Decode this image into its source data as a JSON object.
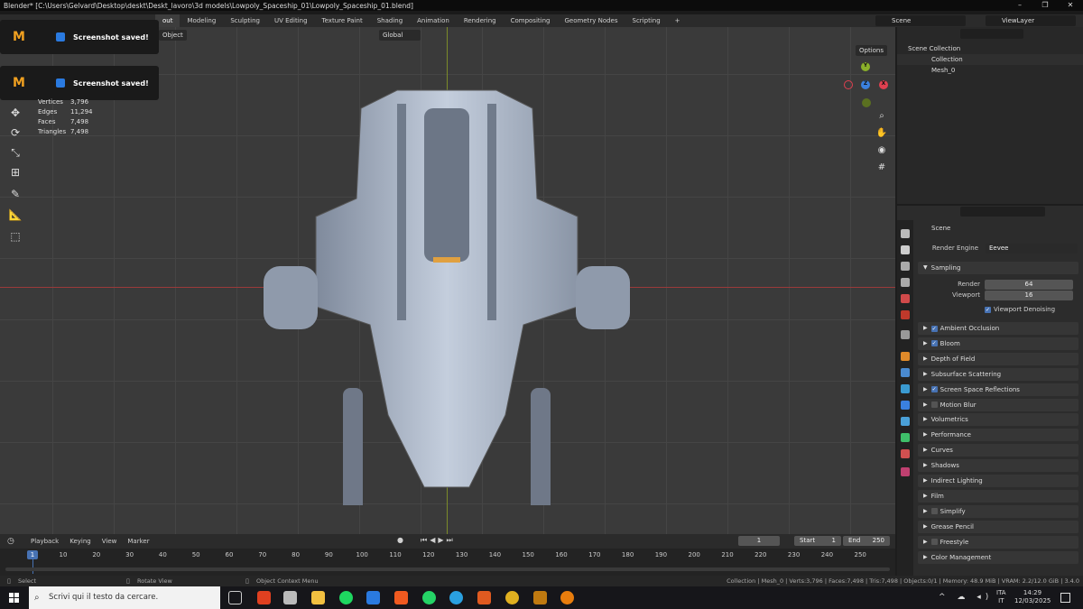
{
  "window": {
    "title": "Blender* [C:\\Users\\Gelvard\\Desktop\\deskt\\Deskt_lavoro\\3d models\\Lowpoly_Spaceship_01\\Lowpoly_Spaceship_01.blend]",
    "min": "–",
    "max": "❐",
    "close": "✕"
  },
  "workspaces": [
    "out",
    "Modeling",
    "Sculpting",
    "UV Editing",
    "Texture Paint",
    "Shading",
    "Animation",
    "Rendering",
    "Compositing",
    "Geometry Nodes",
    "Scripting",
    "+"
  ],
  "scene": {
    "name": "Scene",
    "view_layer": "ViewLayer"
  },
  "viewport": {
    "mode_menu": "Object",
    "orientation": "Global",
    "options": "Options",
    "stats": [
      {
        "label": "Vertices",
        "value": "3,796"
      },
      {
        "label": "Edges",
        "value": "11,294"
      },
      {
        "label": "Faces",
        "value": "7,498"
      },
      {
        "label": "Triangles",
        "value": "7,498"
      }
    ],
    "gizmo": {
      "x": "X",
      "y": "Y",
      "z": "Z"
    }
  },
  "toasts": [
    {
      "logo": "M",
      "text": "Screenshot saved!"
    },
    {
      "logo": "M",
      "text": "Screenshot saved!"
    }
  ],
  "outliner": {
    "root": "Scene Collection",
    "items": [
      {
        "label": "Collection"
      },
      {
        "label": "Mesh_0"
      }
    ]
  },
  "properties": {
    "context": "Scene",
    "render_engine_label": "Render Engine",
    "render_engine": "Eevee",
    "sampling": {
      "title": "Sampling",
      "render_label": "Render",
      "render": "64",
      "viewport_label": "Viewport",
      "viewport": "16",
      "denoise": "Viewport Denoising"
    },
    "panels": [
      {
        "label": "Ambient Occlusion",
        "check": "on"
      },
      {
        "label": "Bloom",
        "check": "on"
      },
      {
        "label": "Depth of Field",
        "check": "none"
      },
      {
        "label": "Subsurface Scattering",
        "check": "none"
      },
      {
        "label": "Screen Space Reflections",
        "check": "on"
      },
      {
        "label": "Motion Blur",
        "check": "off"
      },
      {
        "label": "Volumetrics",
        "check": "none"
      },
      {
        "label": "Performance",
        "check": "none"
      },
      {
        "label": "Curves",
        "check": "none"
      },
      {
        "label": "Shadows",
        "check": "none"
      },
      {
        "label": "Indirect Lighting",
        "check": "none"
      },
      {
        "label": "Film",
        "check": "none"
      },
      {
        "label": "Simplify",
        "check": "off"
      },
      {
        "label": "Grease Pencil",
        "check": "none"
      },
      {
        "label": "Freestyle",
        "check": "off"
      },
      {
        "label": "Color Management",
        "check": "none"
      }
    ]
  },
  "timeline": {
    "menus": [
      "Playback",
      "Keying",
      "View",
      "Marker"
    ],
    "current_frame": "1",
    "start_label": "Start",
    "start": "1",
    "end_label": "End",
    "end": "250",
    "playhead": "1",
    "frames": [
      "10",
      "20",
      "30",
      "40",
      "50",
      "60",
      "70",
      "80",
      "90",
      "100",
      "110",
      "120",
      "130",
      "140",
      "150",
      "160",
      "170",
      "180",
      "190",
      "200",
      "210",
      "220",
      "230",
      "240",
      "250"
    ]
  },
  "statusbar": {
    "select": "Select",
    "rotate": "Rotate View",
    "context": "Object Context Menu",
    "info": "Collection | Mesh_0 | Verts:3,796 | Faces:7,498 | Tris:7,498 | Objects:0/1 | Memory: 48.9 MiB | VRAM: 2.2/12.0 GiB | 3.4.0"
  },
  "taskbar": {
    "search_placeholder": "Scrivi qui il testo da cercare.",
    "lang": "ITA",
    "lang_sub": "IT",
    "time": "14:29",
    "date": "12/03/2025"
  }
}
